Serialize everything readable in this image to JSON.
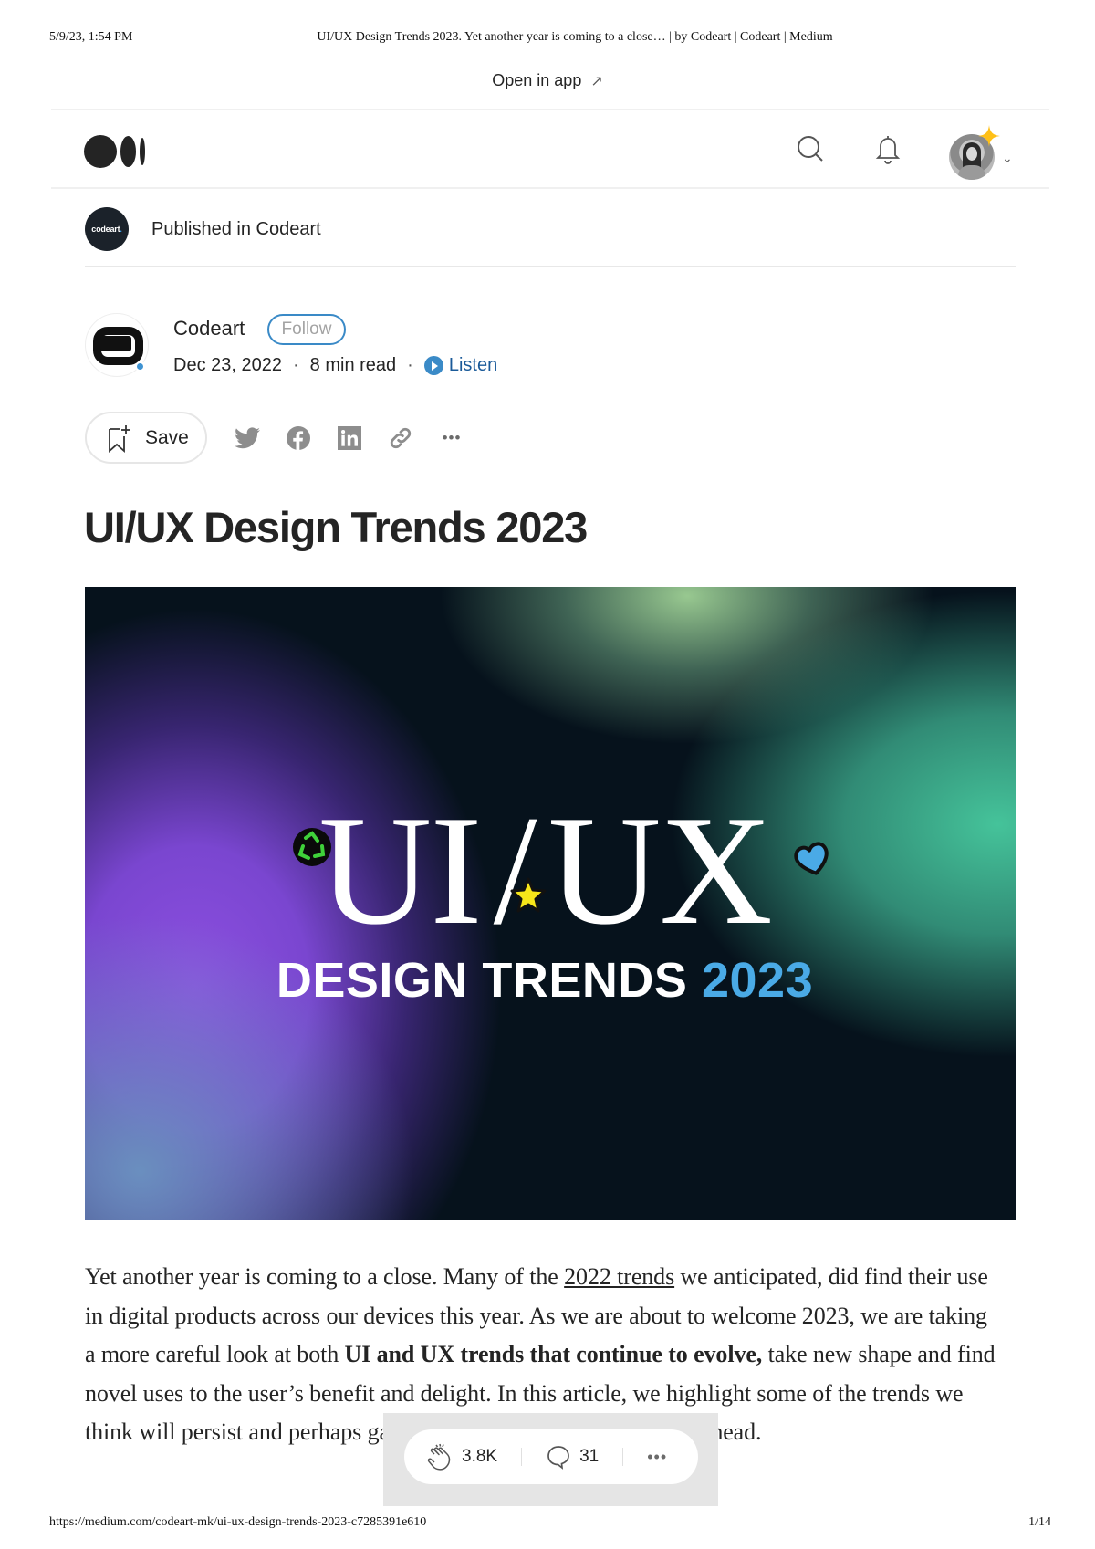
{
  "print_header": {
    "datetime": "5/9/23, 1:54 PM",
    "page_title": "UI/UX Design Trends 2023. Yet another year is coming to a close… | by Codeart | Codeart | Medium"
  },
  "banner": {
    "open_in_app": "Open in app",
    "arrow_icon": "↗"
  },
  "navbar": {
    "logo": "medium-logo",
    "icons": [
      "search-icon",
      "bell-icon"
    ],
    "avatar_alt": "user-avatar",
    "chevron": "⌄"
  },
  "publication": {
    "logo_text": "codeart",
    "logo_dot": ".",
    "label": "Published in Codeart"
  },
  "author": {
    "name": "Codeart",
    "follow_label": "Follow",
    "date": "Dec 23, 2022",
    "sep": "·",
    "read_time": "8 min read",
    "listen_label": "Listen"
  },
  "actions": {
    "save_label": "Save",
    "share_icons": [
      "twitter-icon",
      "facebook-icon",
      "linkedin-icon",
      "link-icon",
      "more-icon"
    ],
    "more_glyph": "•••"
  },
  "article": {
    "title": "UI/UX Design Trends 2023",
    "hero": {
      "big_left": "UI",
      "slash": "/",
      "big_right": "UX",
      "sub_text": "DESIGN TRENDS",
      "sub_year": "2023",
      "stickers": [
        "recycle-icon",
        "star-icon",
        "heart-icon"
      ]
    },
    "paragraph": {
      "part1": "Yet another year is coming to a close. Many of the ",
      "link": "2022 trends",
      "part2": " we anticipated, did find their use in digital products across our devices this year. As we are about to welcome 2023, we are taking a more careful look at both ",
      "bold": "UI and UX trends that continue to evolve,",
      "part3": " take new shape and find novel uses to the user’s benefit and delight. In this article, we highlight some of the trends we think will persist and perhaps gain even more traction in the year ahead."
    }
  },
  "floating_bar": {
    "claps": "3.8K",
    "responses": "31",
    "more_glyph": "•••"
  },
  "print_footer": {
    "url": "https://medium.com/codeart-mk/ui-ux-design-trends-2023-c7285391e610",
    "page": "1/14"
  },
  "colors": {
    "accent_blue": "#3a8ac7",
    "text": "#242424",
    "hero_year": "#4aaae6",
    "sparkle": "#ffc017"
  }
}
